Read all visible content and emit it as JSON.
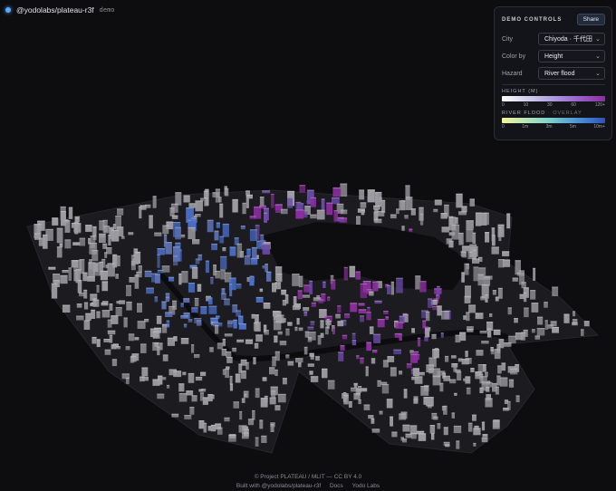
{
  "header": {
    "repo": "@yodolabs/plateau-r3f",
    "tag": "demo"
  },
  "panel": {
    "title": "DEMO CONTROLS",
    "share_label": "Share",
    "controls": [
      {
        "label": "City",
        "value": "Chiyoda · 千代田"
      },
      {
        "label": "Color by",
        "value": "Height"
      },
      {
        "label": "Hazard",
        "value": "River flood"
      }
    ],
    "legend_height": {
      "title": "HEIGHT (M)",
      "ticks": [
        "0",
        "10",
        "30",
        "60",
        "120+"
      ]
    },
    "legend_flood": {
      "title": "RIVER FLOOD",
      "subtitle": "· OVERLAY",
      "ticks": [
        "0",
        "1m",
        "3m",
        "5m",
        "10m+"
      ]
    }
  },
  "footer": {
    "attribution": "© Project PLATEAU / MLIT — CC BY 4.0",
    "built_with": "Built with @yodolabs/plateau-r3f",
    "docs": "Docs",
    "company": "Yodo Labs"
  },
  "colors": {
    "background": "#0d0d10",
    "building_grey": "#9c9ca2",
    "height_purple": "#8a2e9e",
    "flood_blue": "#4a6fc8",
    "accent_dot": "#5aa9ff"
  }
}
